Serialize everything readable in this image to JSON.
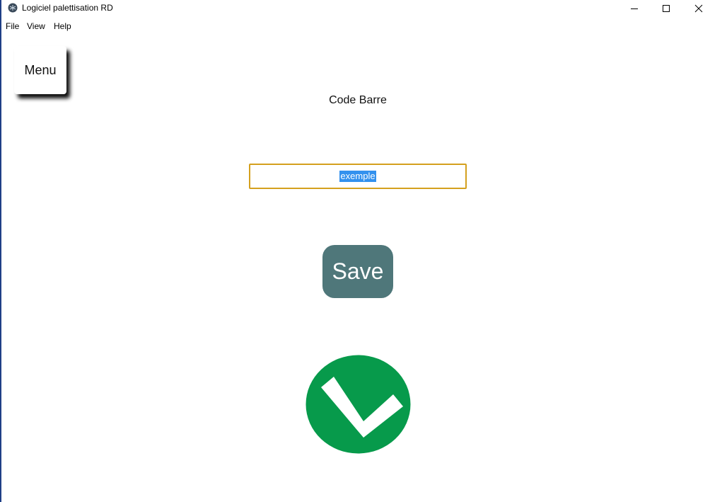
{
  "window": {
    "title": "Logiciel palettisation RD",
    "icon": "app-icon"
  },
  "menubar": {
    "items": [
      "File",
      "View",
      "Help"
    ]
  },
  "menu_button": {
    "label": "Menu"
  },
  "form": {
    "label": "Code Barre",
    "input_value": "exemple",
    "save_label": "Save"
  },
  "status": {
    "icon": "check-icon",
    "color": "#079a4b"
  },
  "colors": {
    "save_button": "#4f777a",
    "input_border": "#d4a01e",
    "selection": "#3391ee"
  }
}
